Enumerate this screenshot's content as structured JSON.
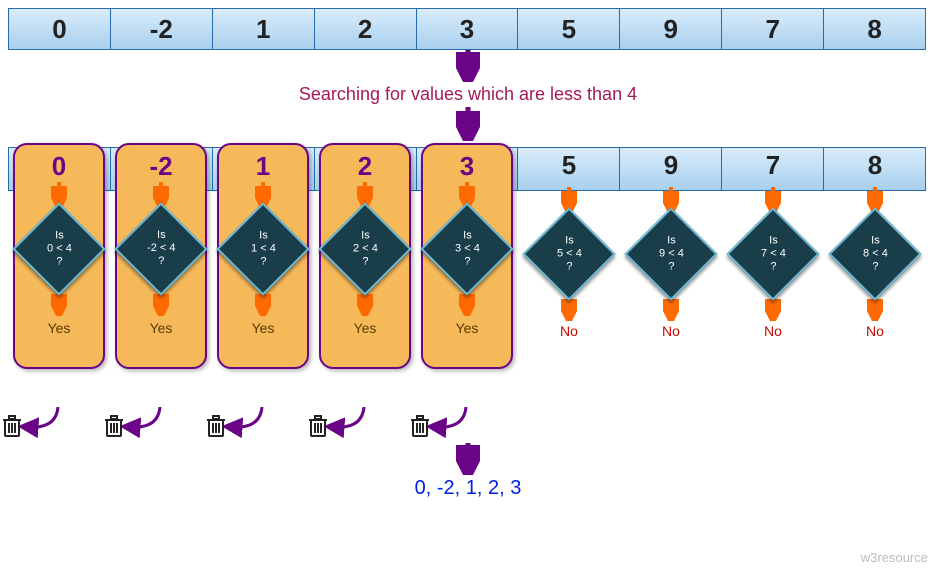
{
  "array": [
    "0",
    "-2",
    "1",
    "2",
    "3",
    "5",
    "9",
    "7",
    "8"
  ],
  "caption": "Searching for values which are less than 4",
  "threshold": 4,
  "columns": [
    {
      "value": "0",
      "condition_top": "Is",
      "condition_mid": "0 < 4",
      "condition_bot": "?",
      "answer": "Yes",
      "pass": true
    },
    {
      "value": "-2",
      "condition_top": "Is",
      "condition_mid": "-2 < 4",
      "condition_bot": "?",
      "answer": "Yes",
      "pass": true
    },
    {
      "value": "1",
      "condition_top": "Is",
      "condition_mid": "1 < 4",
      "condition_bot": "?",
      "answer": "Yes",
      "pass": true
    },
    {
      "value": "2",
      "condition_top": "Is",
      "condition_mid": "2 < 4",
      "condition_bot": "?",
      "answer": "Yes",
      "pass": true
    },
    {
      "value": "3",
      "condition_top": "Is",
      "condition_mid": "3 < 4",
      "condition_bot": "?",
      "answer": "Yes",
      "pass": true
    },
    {
      "value": "5",
      "condition_top": "Is",
      "condition_mid": "5 < 4",
      "condition_bot": "?",
      "answer": "No",
      "pass": false
    },
    {
      "value": "9",
      "condition_top": "Is",
      "condition_mid": "9 < 4",
      "condition_bot": "?",
      "answer": "No",
      "pass": false
    },
    {
      "value": "7",
      "condition_top": "Is",
      "condition_mid": "7 < 4",
      "condition_bot": "?",
      "answer": "No",
      "pass": false
    },
    {
      "value": "8",
      "condition_top": "Is",
      "condition_mid": "8 < 4",
      "condition_bot": "?",
      "answer": "No",
      "pass": false
    }
  ],
  "result": "0, -2, 1, 2, 3",
  "attribution": "w3resource",
  "colors": {
    "accent_purple": "#6b0587",
    "accent_orange": "#ff6a00",
    "diamond_fill": "#1a3d4a",
    "caption": "#a51a56",
    "result": "#0022dd"
  }
}
